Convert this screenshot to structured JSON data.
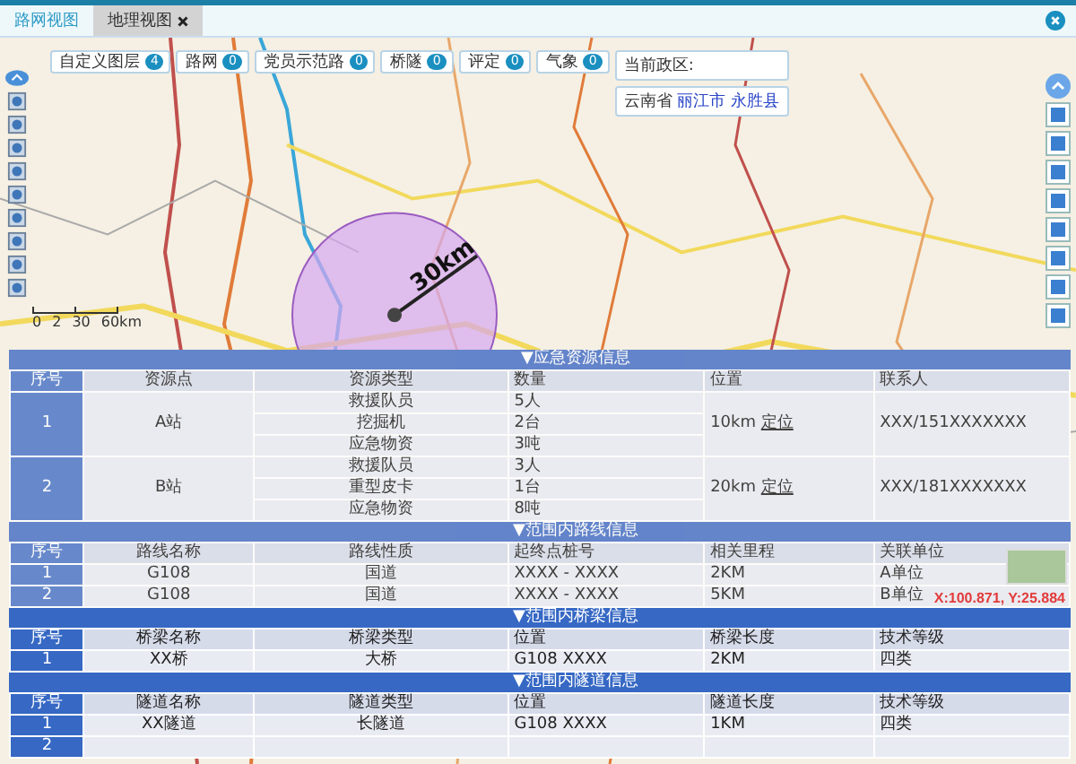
{
  "tabs": [
    {
      "label": "路网视图",
      "selected": false,
      "closable": false
    },
    {
      "label": "地理视图",
      "selected": true,
      "closable": true
    }
  ],
  "filters": [
    {
      "label": "自定义图层",
      "count": "4"
    },
    {
      "label": "路网",
      "count": "0"
    },
    {
      "label": "党员示范路",
      "count": "0"
    },
    {
      "label": "桥隧",
      "count": "0"
    },
    {
      "label": "评定",
      "count": "0"
    },
    {
      "label": "气象",
      "count": "0"
    }
  ],
  "region": {
    "label": "当前政区:",
    "province": "云南省",
    "city": "丽江市",
    "county": "永胜县"
  },
  "range_label": "30km",
  "scale": [
    "0",
    "2",
    "30",
    "60km"
  ],
  "coordinates": "X:100.871, Y:25.884",
  "sections": [
    {
      "title": "▼应急资源信息",
      "kind": "resource",
      "transparent": true,
      "columns": [
        "序号",
        "资源点",
        "资源类型",
        "数量",
        "位置",
        "联系人"
      ],
      "rows": [
        {
          "index": "1",
          "point": "A站",
          "items": [
            {
              "type": "救援队员",
              "amount": "5人"
            },
            {
              "type": "挖掘机",
              "amount": "2台"
            },
            {
              "type": "应急物资",
              "amount": "3吨"
            }
          ],
          "distance": "10km",
          "link": "定位",
          "contact": "XXX/151XXXXXXX"
        },
        {
          "index": "2",
          "point": "B站",
          "items": [
            {
              "type": "救援队员",
              "amount": "3人"
            },
            {
              "type": "重型皮卡",
              "amount": "1台"
            },
            {
              "type": "应急物资",
              "amount": "8吨"
            }
          ],
          "distance": "20km",
          "link": "定位",
          "contact": "XXX/181XXXXXXX"
        }
      ]
    },
    {
      "title": "▼范围内路线信息",
      "kind": "plain",
      "transparent": true,
      "columns": [
        "序号",
        "路线名称",
        "路线性质",
        "起终点桩号",
        "相关里程",
        "关联单位"
      ],
      "rows": [
        {
          "cells": [
            "1",
            "G108",
            "国道",
            "XXXX - XXXX",
            "2KM",
            "A单位"
          ]
        },
        {
          "cells": [
            "2",
            "G108",
            "国道",
            "XXXX - XXXX",
            "5KM",
            "B单位"
          ]
        }
      ]
    },
    {
      "title": "▼范围内桥梁信息",
      "kind": "plain",
      "transparent": false,
      "columns": [
        "序号",
        "桥梁名称",
        "桥梁类型",
        "位置",
        "桥梁长度",
        "技术等级"
      ],
      "rows": [
        {
          "cells": [
            "1",
            "XX桥",
            "大桥",
            "G108 XXXX",
            "2KM",
            "四类"
          ]
        }
      ]
    },
    {
      "title": "▼范围内隧道信息",
      "kind": "plain",
      "transparent": false,
      "columns": [
        "序号",
        "隧道名称",
        "隧道类型",
        "位置",
        "隧道长度",
        "技术等级"
      ],
      "rows": [
        {
          "cells": [
            "1",
            "XX隧道",
            "长隧道",
            "G108 XXXX",
            "1KM",
            "四类"
          ]
        },
        {
          "cells": [
            "2"
          ]
        }
      ]
    }
  ]
}
